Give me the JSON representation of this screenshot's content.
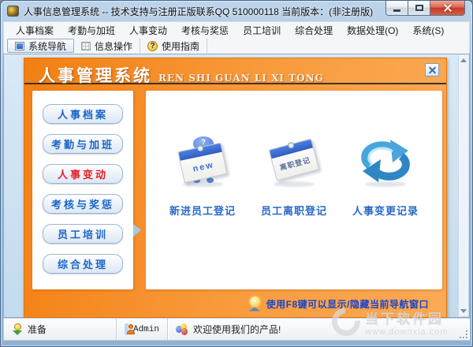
{
  "window": {
    "title": "人事信息管理系统 -- 技术支持与注册正版联系QQ 510000118   当前版本：(非注册版)"
  },
  "menu": {
    "items": [
      "人事档案",
      "考勤与加班",
      "人事变动",
      "考核与奖惩",
      "员工培训",
      "综合处理",
      "数据处理(O)",
      "系统(S)"
    ]
  },
  "toolbar": {
    "nav_label": "系统导航",
    "info_label": "信息操作",
    "guide_label": "使用指南",
    "guide_glyph": "?"
  },
  "panel": {
    "title_cn": "人事管理系统",
    "title_en": "REN SHI GUAN LI XI TONG",
    "sidebar": [
      {
        "label": "人事档案"
      },
      {
        "label": "考勤与加班"
      },
      {
        "label": "人事变动"
      },
      {
        "label": "考核与奖惩"
      },
      {
        "label": "员工培训"
      },
      {
        "label": "综合处理"
      }
    ],
    "items": [
      {
        "label": "新进员工登记",
        "icon_text": "new",
        "creature_glyph": "?"
      },
      {
        "label": "员工离职登记",
        "icon_text": "离职登记"
      },
      {
        "label": "人事变更记录"
      }
    ],
    "tip": "使用F8键可以显示/隐藏当前导航窗口"
  },
  "statusbar": {
    "ready": "准备",
    "user": "Admin",
    "welcome": "欢迎使用我们的产品!"
  },
  "watermark": {
    "name": "当下软件园",
    "url": "www.downxia.com"
  },
  "colors": {
    "panel_orange": "#f6891f",
    "active_red": "#e81f24",
    "nav_blue": "#1a64c8",
    "header_text": "#ffffff"
  }
}
